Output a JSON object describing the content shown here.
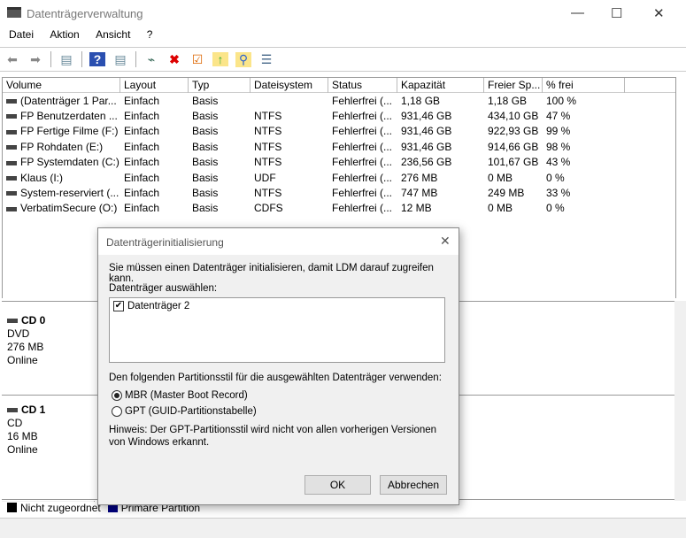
{
  "window": {
    "title": "Datenträgerverwaltung",
    "minimize": "—",
    "maximize": "☐",
    "close": "✕"
  },
  "menu": [
    "Datei",
    "Aktion",
    "Ansicht",
    "?"
  ],
  "table": {
    "headers": [
      "Volume",
      "Layout",
      "Typ",
      "Dateisystem",
      "Status",
      "Kapazität",
      "Freier Sp...",
      "% frei"
    ],
    "rows": [
      [
        "(Datenträger 1 Par...",
        "Einfach",
        "Basis",
        "",
        "Fehlerfrei (...",
        "1,18 GB",
        "1,18 GB",
        "100 %"
      ],
      [
        "FP Benutzerdaten ...",
        "Einfach",
        "Basis",
        "NTFS",
        "Fehlerfrei (...",
        "931,46 GB",
        "434,10 GB",
        "47 %"
      ],
      [
        "FP Fertige Filme (F:)",
        "Einfach",
        "Basis",
        "NTFS",
        "Fehlerfrei (...",
        "931,46 GB",
        "922,93 GB",
        "99 %"
      ],
      [
        "FP Rohdaten (E:)",
        "Einfach",
        "Basis",
        "NTFS",
        "Fehlerfrei (...",
        "931,46 GB",
        "914,66 GB",
        "98 %"
      ],
      [
        "FP Systemdaten (C:)",
        "Einfach",
        "Basis",
        "NTFS",
        "Fehlerfrei (...",
        "236,56 GB",
        "101,67 GB",
        "43 %"
      ],
      [
        "Klaus (I:)",
        "Einfach",
        "Basis",
        "UDF",
        "Fehlerfrei (...",
        "276 MB",
        "0 MB",
        "0 %"
      ],
      [
        "System-reserviert (...",
        "Einfach",
        "Basis",
        "NTFS",
        "Fehlerfrei (...",
        "747 MB",
        "249 MB",
        "33 %"
      ],
      [
        "VerbatimSecure (O:)",
        "Einfach",
        "Basis",
        "CDFS",
        "Fehlerfrei (...",
        "12 MB",
        "0 MB",
        "0 %"
      ]
    ]
  },
  "disks": [
    {
      "name": "CD 0",
      "type": "DVD",
      "size": "276 MB",
      "state": "Online"
    },
    {
      "name": "CD 1",
      "type": "CD",
      "size": "16 MB",
      "state": "Online"
    }
  ],
  "legend": [
    {
      "label": "Nicht zugeordnet",
      "color": "#000000"
    },
    {
      "label": "Primäre Partition",
      "color": "#00007f"
    }
  ],
  "dialog": {
    "title": "Datenträgerinitialisierung",
    "intro": "Sie müssen einen Datenträger initialisieren, damit LDM darauf zugreifen kann.",
    "select_label": "Datenträger auswählen:",
    "disk_item": "Datenträger 2",
    "style_label": "Den folgenden Partitionsstil für die ausgewählten Datenträger verwenden:",
    "mbr": "MBR (Master Boot Record)",
    "gpt": "GPT (GUID-Partitionstabelle)",
    "hint": "Hinweis: Der GPT-Partitionsstil wird nicht von allen vorherigen Versionen von Windows erkannt.",
    "ok": "OK",
    "cancel": "Abbrechen",
    "close": "✕"
  }
}
